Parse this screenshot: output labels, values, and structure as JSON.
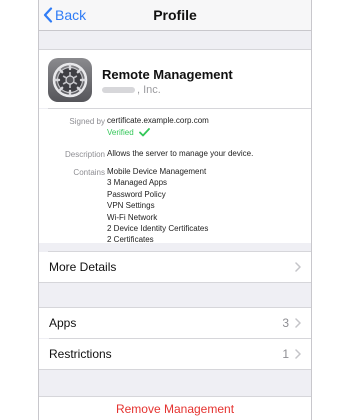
{
  "nav": {
    "back_label": "Back",
    "title": "Profile"
  },
  "profile": {
    "icon": "settings-gear-icon",
    "name": "Remote Management",
    "org_suffix": ", Inc."
  },
  "details": {
    "signed_by_label": "Signed by",
    "signed_by_value": "certificate.example.corp.com",
    "verified_label": "Verified",
    "description_label": "Description",
    "description_value": "Allows the server to manage your device.",
    "contains_label": "Contains",
    "contains_items": [
      "Mobile Device Management",
      "3 Managed Apps",
      "Password Policy",
      "VPN Settings",
      "Wi-Fi Network",
      "2 Device Identity Certificates",
      "2 Certificates"
    ]
  },
  "more_details": {
    "label": "More Details"
  },
  "list": [
    {
      "label": "Apps",
      "count": "3"
    },
    {
      "label": "Restrictions",
      "count": "1"
    }
  ],
  "remove": {
    "label": "Remove Management"
  },
  "colors": {
    "accent": "#2f7cf6",
    "verified": "#34c759",
    "destructive": "#e5322f"
  }
}
